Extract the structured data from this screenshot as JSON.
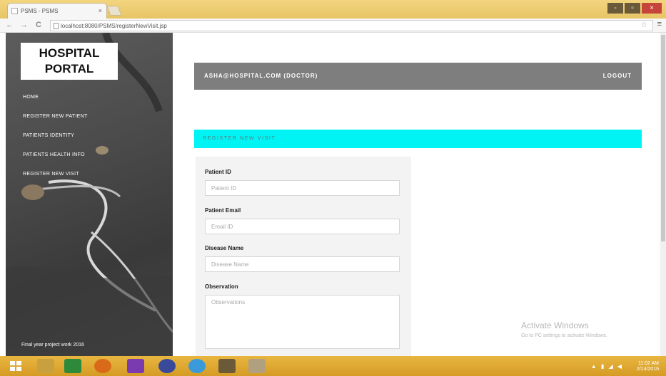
{
  "browser": {
    "tab_title": "PSMS - PSMS",
    "url": "localhost:8080/PSMS/registerNewVisit.jsp",
    "tab_close": "×",
    "nav_back": "←",
    "nav_forward": "→",
    "nav_reload": "C",
    "star": "☆",
    "menu": "≡",
    "window_minimize": "-",
    "window_restore": "▫",
    "window_close": "×"
  },
  "sidebar": {
    "logo_line1": "HOSPITAL",
    "logo_line2": "PORTAL",
    "items": [
      {
        "label": "HOME"
      },
      {
        "label": "REGISTER NEW PATIENT"
      },
      {
        "label": "PATIENTS IDENTITY"
      },
      {
        "label": "PATIENTS HEALTH INFO"
      },
      {
        "label": "REGISTER NEW VISIT"
      }
    ],
    "footer": "Final year project work 2016"
  },
  "topbar": {
    "user": "ASHA@HOSPITAL.COM (DOCTOR)",
    "logout": "LOGOUT"
  },
  "section_title": "REGISTER NEW VISIT",
  "form": {
    "patient_id_label": "Patient ID",
    "patient_id_placeholder": "Patient ID",
    "patient_email_label": "Patient Email",
    "patient_email_placeholder": "Email ID",
    "disease_label": "Disease Name",
    "disease_placeholder": "Disease Name",
    "observation_label": "Observation",
    "observation_placeholder": "Observations"
  },
  "watermark": {
    "title": "Activate Windows",
    "subtitle": "Go to PC settings to activate Windows."
  },
  "taskbar": {
    "tray_time": "11:02 AM",
    "tray_date": "2/14/2016",
    "colors": [
      "#4a7a2a",
      "#2d8a3a",
      "#d96a1a",
      "#7a3ab0",
      "#3a4a9a",
      "#3a9ad9",
      "#6a5a3a",
      "#9a9a9a"
    ]
  }
}
